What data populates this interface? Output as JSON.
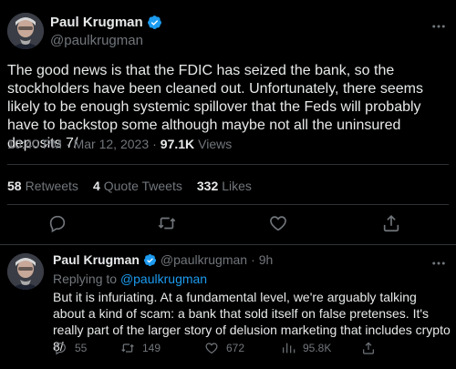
{
  "colors": {
    "background": "#000000",
    "text": "#e7e9ea",
    "muted": "#71767b",
    "accent": "#1d9bf0",
    "divider": "#2f3336"
  },
  "main_tweet": {
    "display_name": "Paul Krugman",
    "handle": "@paulkrugman",
    "more_icon": "more-dots-icon",
    "verified_icon": "verified-badge-icon",
    "text": "The good news is that the FDIC has seized the bank, so the stockholders have been cleaned out. Unfortunately, there seems likely to be enough systemic spillover that the Feds will probably have to backstop some although maybe not all the uninsured deposits 7/",
    "time": "10:40 PM",
    "separator": "·",
    "date": "Mar 12, 2023",
    "views_count": "97.1K",
    "views_label": "Views",
    "stats": {
      "retweets_count": "58",
      "retweets_label": "Retweets",
      "quotes_count": "4",
      "quotes_label": "Quote Tweets",
      "likes_count": "332",
      "likes_label": "Likes"
    },
    "actions": [
      "reply-icon",
      "retweet-icon",
      "like-icon",
      "share-icon"
    ]
  },
  "reply_tweet": {
    "display_name": "Paul Krugman",
    "handle": "@paulkrugman",
    "time": "9h",
    "separator": "·",
    "replying_prefix": "Replying to",
    "replying_handle": "@paulkrugman",
    "text": "But it is infuriating. At a fundamental level, we're arguably talking about a kind of scam: a bank that sold itself on false pretenses. It's really part of the larger story of delusion marketing that includes crypto 8/",
    "counts": {
      "replies": "55",
      "retweets": "149",
      "likes": "672",
      "views": "95.8K"
    }
  }
}
